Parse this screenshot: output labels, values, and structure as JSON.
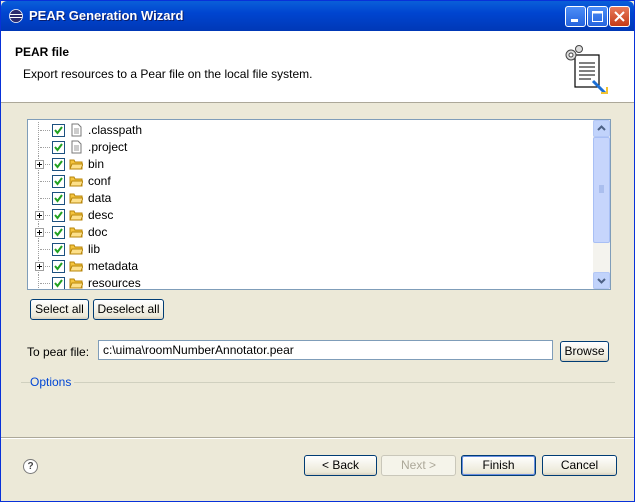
{
  "window": {
    "title": "PEAR Generation Wizard"
  },
  "header": {
    "title": "PEAR file",
    "description": "Export resources to a Pear file on the local file system."
  },
  "tree": {
    "items": [
      {
        "label": ".classpath",
        "type": "file",
        "expandable": false,
        "checked": true
      },
      {
        "label": ".project",
        "type": "file",
        "expandable": false,
        "checked": true
      },
      {
        "label": "bin",
        "type": "folder",
        "expandable": true,
        "checked": true
      },
      {
        "label": "conf",
        "type": "folder",
        "expandable": false,
        "checked": true
      },
      {
        "label": "data",
        "type": "folder",
        "expandable": false,
        "checked": true
      },
      {
        "label": "desc",
        "type": "folder",
        "expandable": true,
        "checked": true
      },
      {
        "label": "doc",
        "type": "folder",
        "expandable": true,
        "checked": true
      },
      {
        "label": "lib",
        "type": "folder",
        "expandable": false,
        "checked": true
      },
      {
        "label": "metadata",
        "type": "folder",
        "expandable": true,
        "checked": true
      },
      {
        "label": "resources",
        "type": "folder",
        "expandable": false,
        "checked": true
      }
    ]
  },
  "selection": {
    "select_all": "Select all",
    "deselect_all": "Deselect all"
  },
  "pear_file": {
    "label": "To pear file:",
    "value": "c:\\uima\\roomNumberAnnotator.pear",
    "browse": "Browse"
  },
  "options": {
    "label": "Options"
  },
  "footer": {
    "help": "?",
    "back": "< Back",
    "next": "Next >",
    "finish": "Finish",
    "cancel": "Cancel"
  },
  "colors": {
    "titlebar": "#0045d0",
    "check": "#21a121",
    "folder": "#f5c43d",
    "link": "#0046d5"
  }
}
